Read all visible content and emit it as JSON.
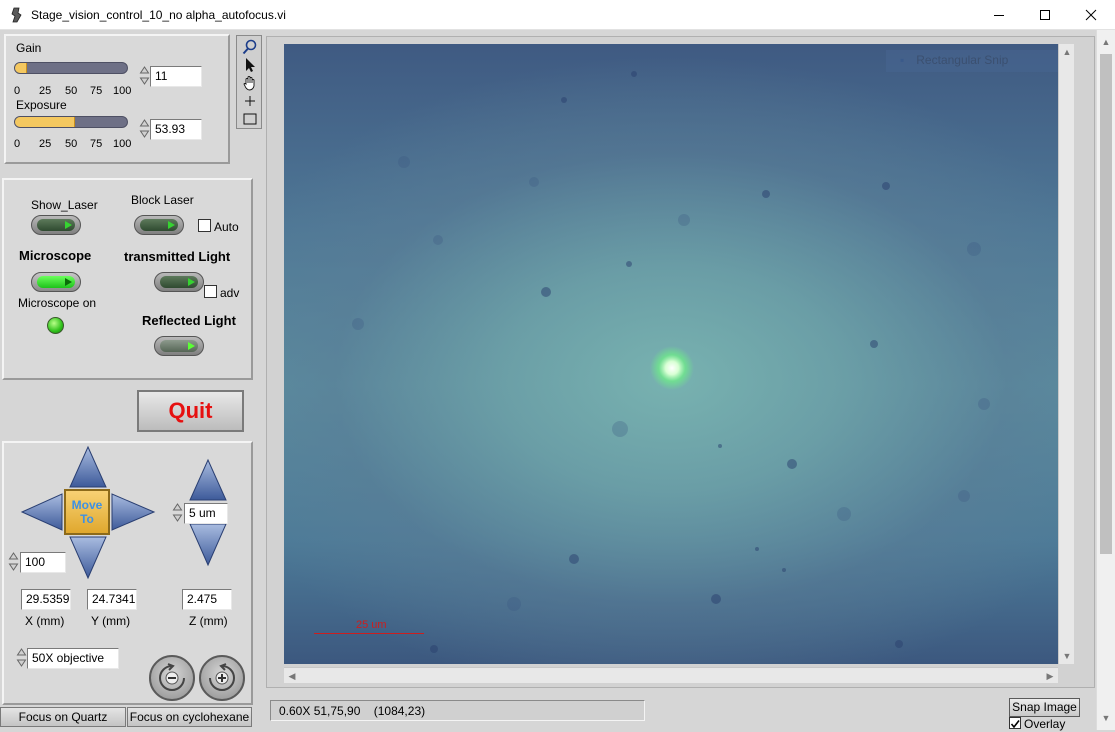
{
  "window": {
    "title": "Stage_vision_control_10_no alpha_autofocus.vi"
  },
  "camera": {
    "gain_label": "Gain",
    "gain_value": "11",
    "gain_fraction": 0.11,
    "exposure_label": "Exposure",
    "exposure_value": "53.93",
    "exposure_fraction": 0.5393,
    "scale_ticks": [
      "0",
      "25",
      "50",
      "75",
      "100"
    ]
  },
  "controls": {
    "show_laser": "Show_Laser",
    "block_laser": "Block Laser",
    "auto": "Auto",
    "microscope": "Microscope",
    "transmitted_light": "transmitted Light",
    "adv": "adv",
    "microscope_on": "Microscope on",
    "reflected_light": "Reflected Light"
  },
  "quit_label": "Quit",
  "stage": {
    "move_to_line1": "Move",
    "move_to_line2": "To",
    "z_step": "5 um",
    "xy_step": "100",
    "x_value": "29.5359",
    "y_value": "24.7341",
    "z_value": "2.475",
    "x_label": "X (mm)",
    "y_label": "Y (mm)",
    "z_label": "Z (mm)",
    "objective": "50X objective"
  },
  "bottom_buttons": {
    "focus_quartz": "Focus on Quartz",
    "focus_cyclohexane": "Focus on cyclohexane"
  },
  "image": {
    "scale_label": "25 um",
    "rect_snip": "Rectangular Snip"
  },
  "status": {
    "text": "0.60X 51,75,90    (1084,23)"
  },
  "snap_image_label": "Snap Image",
  "overlay_label": "Overlay",
  "colors": {
    "quit": "#e61010",
    "led_on": "#2fc11b",
    "slider_fill": "#f4c860",
    "move_to_text": "#3e91e4",
    "scale_bar": "#cc1e1e"
  },
  "icons": {
    "zoom": "magnifier-icon",
    "pointer": "arrow-pointer-icon",
    "pan": "hand-icon",
    "crosshair": "crosshair-icon",
    "rectangle": "rectangle-icon"
  }
}
